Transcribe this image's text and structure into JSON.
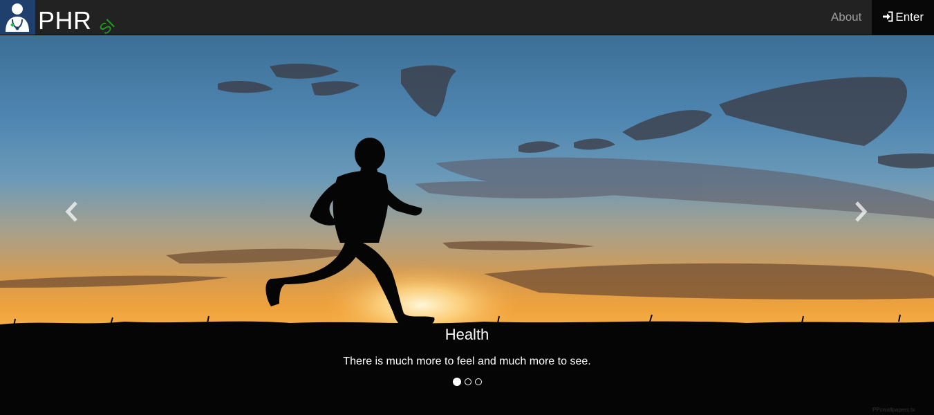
{
  "navbar": {
    "brand_text": "PHR",
    "brand_sub": "SI",
    "about_label": "About",
    "enter_label": "Enter",
    "enter_icon": "sign-in-icon",
    "brand_color": "#1f3f6d",
    "accent_green": "#1e9e1e"
  },
  "carousel": {
    "slides": [
      {
        "title": "Health",
        "text": "There is much more to feel and much more to see."
      }
    ],
    "active_index": 0,
    "indicator_count": 3,
    "prev_icon": "chevron-left-icon",
    "next_icon": "chevron-right-icon",
    "watermark": "PPcwallpapers.tv"
  }
}
